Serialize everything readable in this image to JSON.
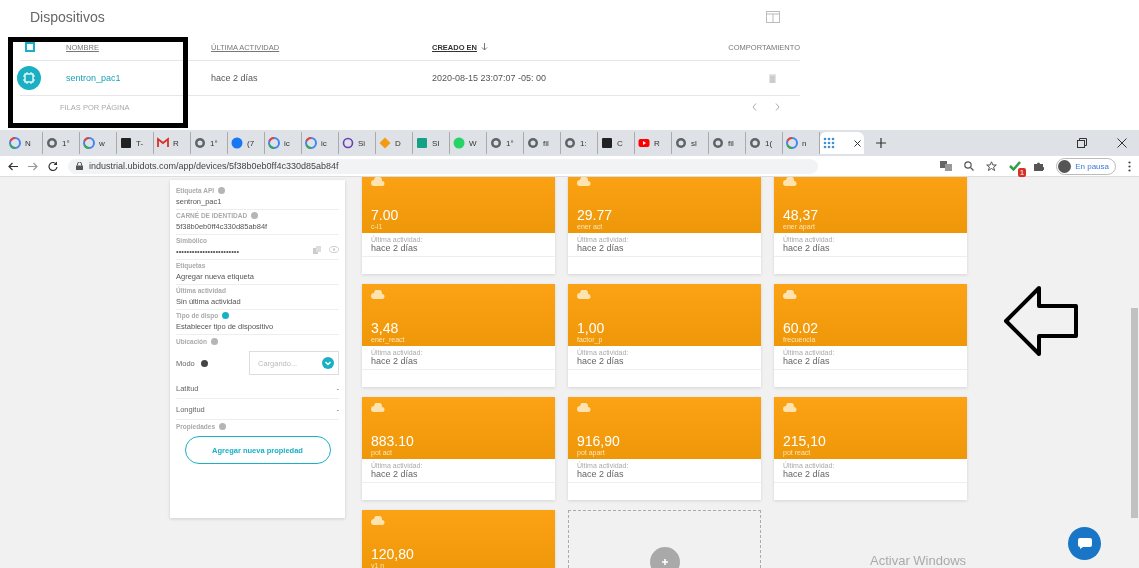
{
  "devices_page": {
    "title": "Dispositivos",
    "select_all": {
      "checked": false
    },
    "columns": [
      {
        "label": "NOMBRE",
        "sorted": false
      },
      {
        "label": "ÚLTIMA ACTIVIDAD",
        "sorted": false
      },
      {
        "label": "CREADO EN",
        "sorted": true
      },
      {
        "label": "COMPORTAMIENTO",
        "sorted": false
      }
    ],
    "rows": [
      {
        "name": "sentron_pac1",
        "last_activity": "hace 2 días",
        "created": "2020-08-15 23:07:07 -05: 00"
      }
    ],
    "footer": {
      "rows_per_page": "FILAS POR PÁGINA"
    }
  },
  "browser": {
    "tabs": [
      {
        "kind": "google",
        "title": "N",
        "selected": false
      },
      {
        "kind": "globe",
        "title": "1°",
        "selected": false
      },
      {
        "kind": "google",
        "title": "w",
        "selected": false
      },
      {
        "kind": "dark",
        "title": "T-",
        "selected": false
      },
      {
        "kind": "mail",
        "title": "R",
        "selected": false
      },
      {
        "kind": "globe",
        "title": "1°",
        "selected": false
      },
      {
        "kind": "facebook",
        "title": "(7",
        "selected": false
      },
      {
        "kind": "google",
        "title": "ic",
        "selected": false
      },
      {
        "kind": "google",
        "title": "ic",
        "selected": false
      },
      {
        "kind": "at",
        "title": "Si",
        "selected": false
      },
      {
        "kind": "diamond",
        "title": "D",
        "selected": false
      },
      {
        "kind": "teal",
        "title": "SI",
        "selected": false
      },
      {
        "kind": "chat",
        "title": "W",
        "selected": false
      },
      {
        "kind": "globe",
        "title": "1°",
        "selected": false
      },
      {
        "kind": "globe",
        "title": "fil",
        "selected": false
      },
      {
        "kind": "globe",
        "title": "1:",
        "selected": false
      },
      {
        "kind": "dark",
        "title": "C",
        "selected": false
      },
      {
        "kind": "video",
        "title": "R",
        "selected": false
      },
      {
        "kind": "globe",
        "title": "sl",
        "selected": false
      },
      {
        "kind": "globe",
        "title": "fil",
        "selected": false
      },
      {
        "kind": "globe",
        "title": "1(",
        "selected": false
      },
      {
        "kind": "google",
        "title": "n",
        "selected": false
      },
      {
        "kind": "apps",
        "selected": true
      }
    ],
    "url": "industrial.ubidots.com/app/devices/5f38b0eb0ff4c330d85ab84f",
    "extension_badge": "1",
    "profile": "En pausa"
  },
  "device_panel": {
    "fields": [
      {
        "kind": "field",
        "label": "Etiqueta API",
        "color": "#b5b5b5",
        "value": "sentron_pac1"
      },
      {
        "kind": "field",
        "label": "CARNÉ DE IDENTIDAD",
        "color": "#b5b5b5",
        "value": "5f38b0eb0ff4c330d85ab84f"
      },
      {
        "kind": "secret",
        "label": "Simbólico",
        "value": "••••••••••••••••••••••••"
      },
      {
        "kind": "field",
        "label": "Etiquetas",
        "value": "Agregar nueva etiqueta"
      },
      {
        "kind": "field",
        "label": "Última actividad",
        "value": "Sin última actividad"
      },
      {
        "kind": "field",
        "label": "Tipo de dispo",
        "color": "#1ab0c4",
        "value": "Establecer tipo de dispositivo"
      },
      {
        "kind": "heading",
        "label": "Ubicación",
        "color": "#b5b5b5"
      },
      {
        "kind": "select",
        "label": "Modo",
        "color": "#444444",
        "placeholder": "Cargando..."
      },
      {
        "kind": "pair",
        "label": "Latitud",
        "value": "-"
      },
      {
        "kind": "pair",
        "label": "Longitud",
        "value": "-"
      },
      {
        "kind": "heading",
        "label": "Propiedades",
        "color": "#b5b5b5"
      }
    ],
    "button": "Agregar nueva propiedad"
  },
  "variables": [
    {
      "kind": "variable",
      "value": "7.00",
      "name": "c-l1",
      "label": "Última actividad:",
      "time": "hace 2 días"
    },
    {
      "kind": "variable",
      "value": "29.77",
      "name": "ener act",
      "label": "Última actividad:",
      "time": "hace 2 días"
    },
    {
      "kind": "variable",
      "value": "48,37",
      "name": "ener apart",
      "label": "Última actividad:",
      "time": "hace 2 días"
    },
    {
      "kind": "variable",
      "value": "3,48",
      "name": "ener_react",
      "label": "Última actividad:",
      "time": "hace 2 días"
    },
    {
      "kind": "variable",
      "value": "1,00",
      "name": "factor_p",
      "label": "Última actividad:",
      "time": "hace 2 días"
    },
    {
      "kind": "variable",
      "value": "60.02",
      "name": "frecuencia",
      "label": "Última actividad:",
      "time": "hace 2 días"
    },
    {
      "kind": "variable",
      "value": "883.10",
      "name": "pot act",
      "label": "Última actividad:",
      "time": "hace 2 días"
    },
    {
      "kind": "variable",
      "value": "916,90",
      "name": "pot apart",
      "label": "Última actividad:",
      "time": "hace 2 días"
    },
    {
      "kind": "variable",
      "value": "215,10",
      "name": "pot react",
      "label": "Última actividad:",
      "time": "hace 2 días"
    },
    {
      "kind": "variable",
      "value": "120,80",
      "name": "v1 n"
    },
    {
      "kind": "add"
    }
  ],
  "os_notice": "Activar Windows"
}
